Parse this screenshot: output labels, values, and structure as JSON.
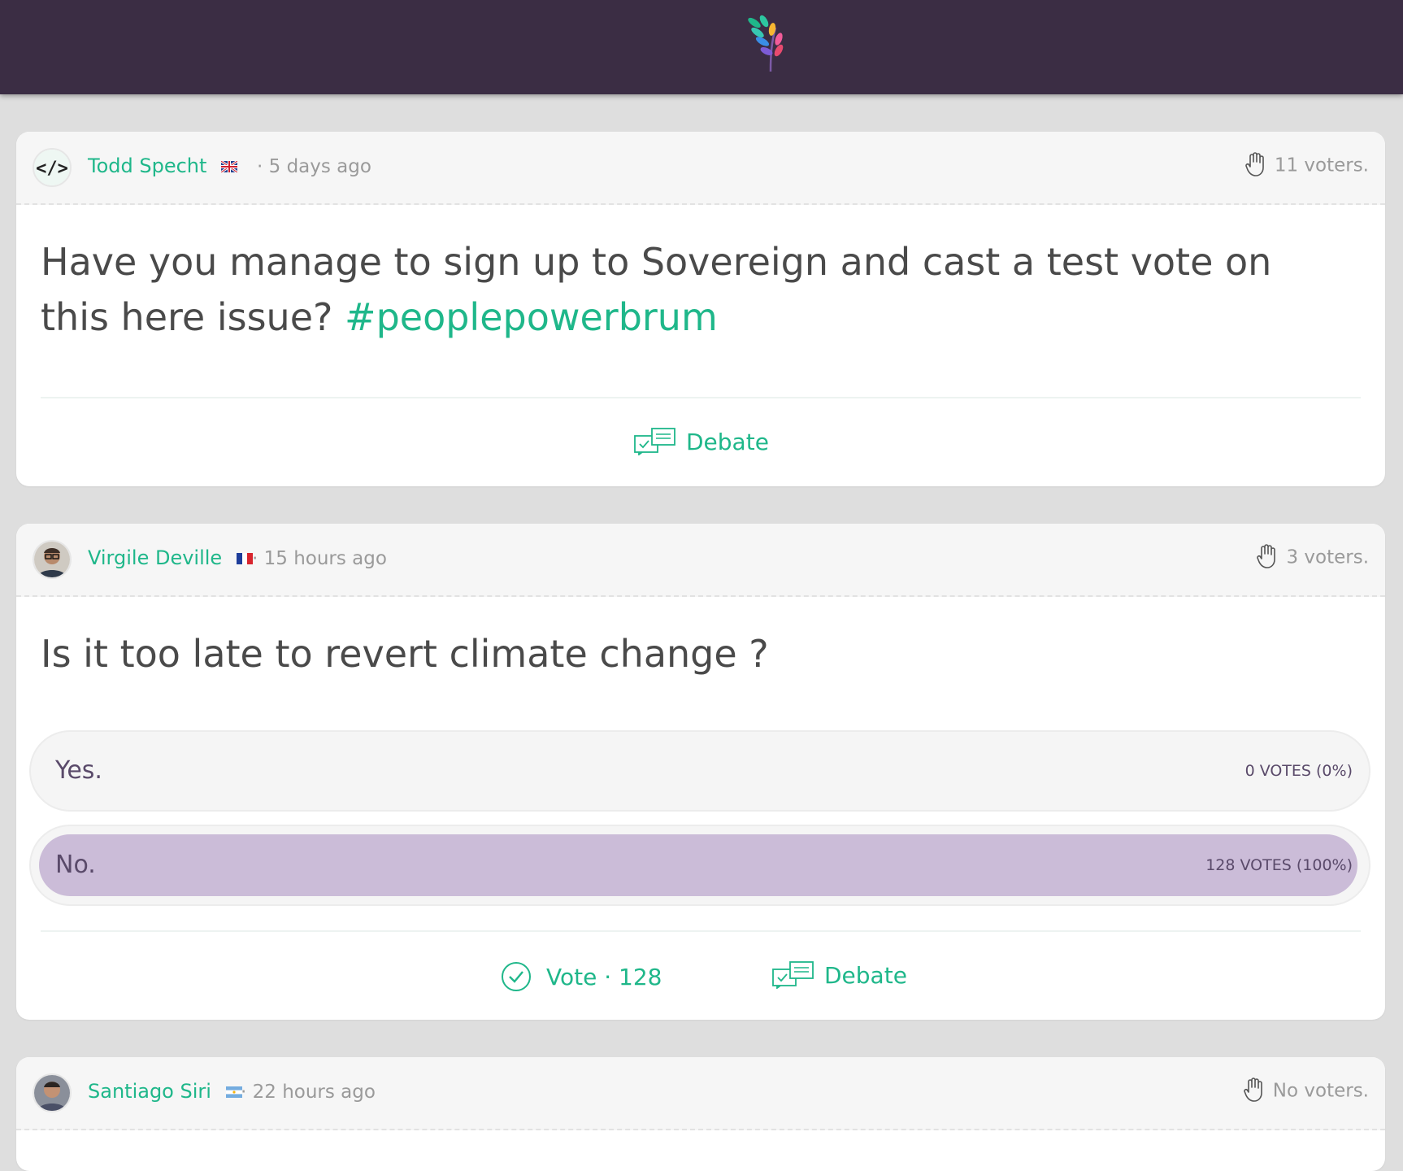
{
  "brand": {
    "logo": "sovereign-leaf-logo-icon"
  },
  "posts": [
    {
      "author": "Todd Specht",
      "flag": "uk-flag-icon",
      "time": "· 5 days ago",
      "voters": "11 voters.",
      "title": "Have you manage to sign up to Sovereign and cast a test vote on this here issue?",
      "hashtag": "#peoplepowerbrum",
      "debate_label": "Debate"
    },
    {
      "author": "Virgile Deville",
      "flag": "france-flag-icon",
      "time": "· 15 hours ago",
      "voters": "3 voters.",
      "title": "Is it too late to revert climate change ?",
      "options": [
        {
          "label": "Yes.",
          "votes": "0 votes (0%)",
          "share": 0
        },
        {
          "label": "No.",
          "votes": "128 votes (100%)",
          "share": 1
        }
      ],
      "vote_label": "Vote · 128",
      "debate_label": "Debate"
    },
    {
      "author": "Santiago Siri",
      "flag": "argentina-flag-icon",
      "time": "· 22 hours ago",
      "voters": "No voters."
    }
  ],
  "colors": {
    "accent": "#1fb78a",
    "topbar": "#3b2d44",
    "option_fill": "#cbbcd8"
  }
}
